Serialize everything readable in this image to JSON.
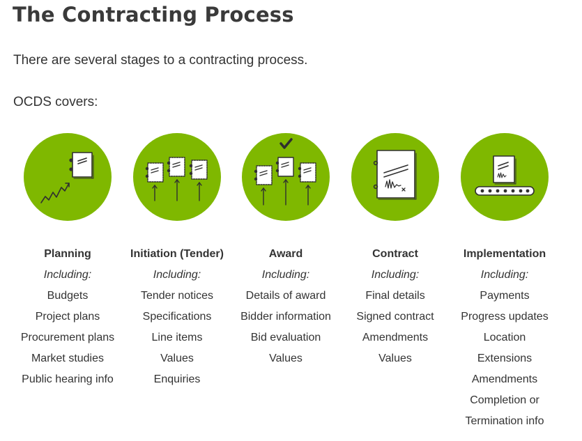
{
  "header": {
    "title": "The Contracting Process",
    "intro": "There are several stages to a contracting process.",
    "covers": "OCDS covers:"
  },
  "colors": {
    "circle_green": "#7fb800",
    "icon_stroke": "#2f2f2f"
  },
  "stages": [
    {
      "title": "Planning",
      "including": "Including:",
      "icon": "planning-document-growth-icon",
      "items": [
        "Budgets",
        "Project plans",
        "Procurement plans",
        "Market studies",
        "Public hearing info"
      ]
    },
    {
      "title": "Initiation (Tender)",
      "including": "Including:",
      "icon": "tender-documents-arrows-icon",
      "items": [
        "Tender notices",
        "Specifications",
        "Line items",
        "Values",
        "Enquiries"
      ]
    },
    {
      "title": "Award",
      "including": "Including:",
      "icon": "award-document-checkmark-icon",
      "items": [
        "Details of award",
        "Bidder information",
        "Bid evaluation",
        "Values"
      ]
    },
    {
      "title": "Contract",
      "including": "Including:",
      "icon": "signed-contract-icon",
      "items": [
        "Final details",
        "Signed contract",
        "Amendments",
        "Values"
      ]
    },
    {
      "title": "Implementation",
      "including": "Including:",
      "icon": "conveyor-document-icon",
      "items": [
        "Payments",
        "Progress updates",
        "Location",
        "Extensions",
        "Amendments",
        "Completion or",
        "Termination info"
      ]
    }
  ]
}
